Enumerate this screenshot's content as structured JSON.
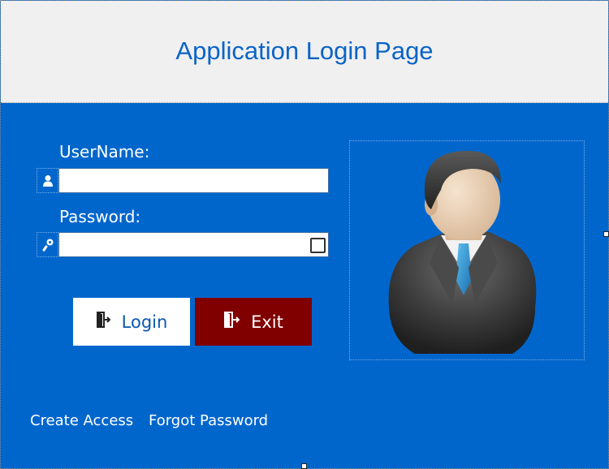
{
  "header": {
    "title": "Application Login Page"
  },
  "form": {
    "username_label": "UserName:",
    "username_value": "",
    "password_label": "Password:",
    "password_value": ""
  },
  "buttons": {
    "login_label": "Login",
    "exit_label": "Exit"
  },
  "links": {
    "create_access": "Create Access",
    "forgot_password": "Forgot Password"
  },
  "icons": {
    "username": "user-icon",
    "password": "key-icon",
    "login": "door-enter-icon",
    "exit": "door-exit-icon",
    "avatar": "businessman-avatar"
  },
  "colors": {
    "background": "#0066cc",
    "header": "#f0f0f0",
    "title": "#0a64c6",
    "login_button": "#ffffff",
    "exit_button": "#800000"
  }
}
